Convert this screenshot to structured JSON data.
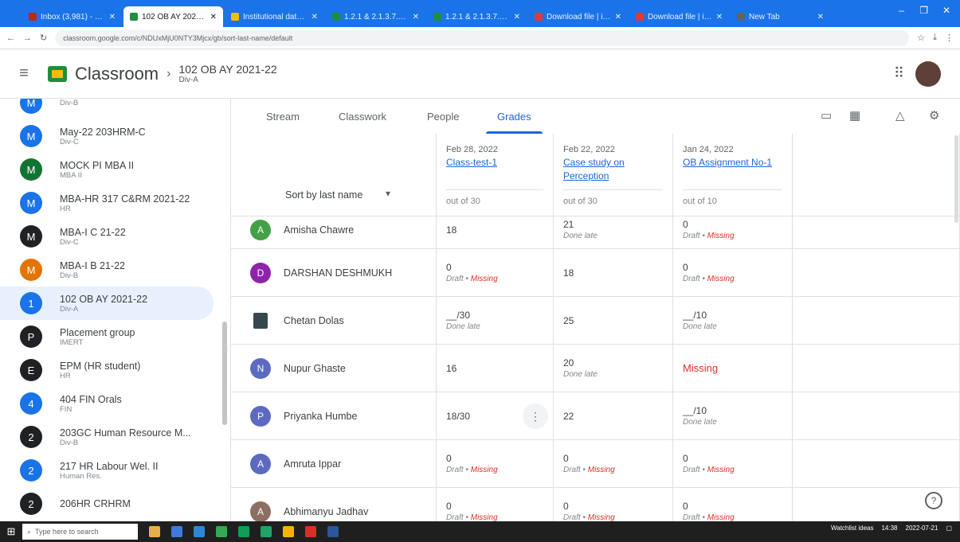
{
  "browser": {
    "tabs": [
      {
        "title": "Inbox (3,981) - vivekana...",
        "fav": "#c5221f",
        "active": false
      },
      {
        "title": "102 OB AY 2021-22 grade...",
        "fav": "#1e8e3e",
        "active": true
      },
      {
        "title": "Institutional data in the p...",
        "fav": "#fbbc04",
        "active": false
      },
      {
        "title": "1.2.1 & 2.1.3.7.xlsx - Goog...",
        "fav": "#1e8e3e",
        "active": false
      },
      {
        "title": "1.2.1 & 2.1.3.7.xlsx - Goog...",
        "fav": "#1e8e3e",
        "active": false
      },
      {
        "title": "Download file | iLovePDF",
        "fav": "#e53935",
        "active": false
      },
      {
        "title": "Download file | iLovePDF",
        "fav": "#e53935",
        "active": false
      },
      {
        "title": "New Tab",
        "fav": "#5f6368",
        "active": false
      }
    ],
    "url": "classroom.google.com/c/NDUxMjU0NTY3Mjcx/gb/sort-last-name/default"
  },
  "header": {
    "app_title": "Classroom",
    "class_name": "102 OB AY 2021-22",
    "class_section": "Div-A"
  },
  "sidebar": {
    "items": [
      {
        "initial": "M",
        "color": "#1a73e8",
        "name": "",
        "sub": "Div-B"
      },
      {
        "initial": "M",
        "color": "#1a73e8",
        "name": "May-22 203HRM-C",
        "sub": "Div-C"
      },
      {
        "initial": "M",
        "color": "#137333",
        "name": "MOCK PI MBA II",
        "sub": "MBA II"
      },
      {
        "initial": "M",
        "color": "#1a73e8",
        "name": "MBA-HR 317 C&RM 2021-22",
        "sub": "HR"
      },
      {
        "initial": "M",
        "color": "#202124",
        "name": "MBA-I C 21-22",
        "sub": "Div-C"
      },
      {
        "initial": "M",
        "color": "#e37400",
        "name": "MBA-I B 21-22",
        "sub": "Div-B"
      },
      {
        "initial": "1",
        "color": "#1a73e8",
        "name": "102 OB AY 2021-22",
        "sub": "Div-A",
        "selected": true
      },
      {
        "initial": "P",
        "color": "#202124",
        "name": "Placement group",
        "sub": "IMERT"
      },
      {
        "initial": "E",
        "color": "#202124",
        "name": "EPM (HR student)",
        "sub": "HR"
      },
      {
        "initial": "4",
        "color": "#1a73e8",
        "name": "404 FIN Orals",
        "sub": "FIN"
      },
      {
        "initial": "2",
        "color": "#202124",
        "name": "203GC Human Resource M...",
        "sub": "Div-B"
      },
      {
        "initial": "2",
        "color": "#1a73e8",
        "name": "217 HR Labour Wel. II",
        "sub": "Human Res."
      },
      {
        "initial": "2",
        "color": "#202124",
        "name": "206HR CRHRM",
        "sub": ""
      }
    ]
  },
  "tabs": {
    "stream": "Stream",
    "classwork": "Classwork",
    "people": "People",
    "grades": "Grades"
  },
  "grid": {
    "sort_label": "Sort by last name",
    "assignments": [
      {
        "date": "Feb 28, 2022",
        "title": "Class-test-1",
        "out_of": "out of 30"
      },
      {
        "date": "Feb 22, 2022",
        "title": "Case study on Perception",
        "out_of": "out of 30"
      },
      {
        "date": "Jan 24, 2022",
        "title": "OB Assignment No-1",
        "out_of": "out of 10"
      }
    ],
    "students": [
      {
        "name": "Amisha Chawre",
        "initial": "A",
        "color": "#43a047",
        "grades": [
          {
            "v": "18",
            "s": ""
          },
          {
            "v": "21",
            "s": "Done late"
          },
          {
            "v": "0",
            "s": "Draft",
            "miss": "Missing"
          }
        ]
      },
      {
        "name": "DARSHAN DESHMUKH",
        "initial": "D",
        "color": "#8e24aa",
        "grades": [
          {
            "v": "0",
            "s": "Draft",
            "miss": "Missing"
          },
          {
            "v": "18",
            "s": ""
          },
          {
            "v": "0",
            "s": "Draft",
            "miss": "Missing"
          }
        ]
      },
      {
        "name": "Chetan Dolas",
        "initial": "",
        "color": "#37474f",
        "grades": [
          {
            "v": "__/30",
            "s": "Done late"
          },
          {
            "v": "25",
            "s": ""
          },
          {
            "v": "__/10",
            "s": "Done late"
          }
        ]
      },
      {
        "name": "Nupur Ghaste",
        "initial": "N",
        "color": "#5c6bc0",
        "grades": [
          {
            "v": "16",
            "s": ""
          },
          {
            "v": "20",
            "s": "Done late"
          },
          {
            "v": "Missing",
            "s": "",
            "red": true
          }
        ]
      },
      {
        "name": "Priyanka Humbe",
        "initial": "P",
        "color": "#5c6bc0",
        "grades": [
          {
            "v": "18/30",
            "s": "",
            "kebab": true
          },
          {
            "v": "22",
            "s": ""
          },
          {
            "v": "__/10",
            "s": "Done late"
          }
        ]
      },
      {
        "name": "Amruta Ippar",
        "initial": "A",
        "color": "#5c6bc0",
        "grades": [
          {
            "v": "0",
            "s": "Draft",
            "miss": "Missing"
          },
          {
            "v": "0",
            "s": "Draft",
            "miss": "Missing"
          },
          {
            "v": "0",
            "s": "Draft",
            "miss": "Missing"
          }
        ]
      },
      {
        "name": "Abhimanyu Jadhav",
        "initial": "A",
        "color": "#8d6e63",
        "grades": [
          {
            "v": "0",
            "s": "Draft",
            "miss": "Missing"
          },
          {
            "v": "0",
            "s": "Draft",
            "miss": "Missing"
          },
          {
            "v": "0",
            "s": "Draft",
            "miss": "Missing"
          }
        ]
      }
    ]
  },
  "taskbar": {
    "search_placeholder": "Type here to search",
    "watchlist": "Watchlist ideas",
    "time": "14:38",
    "date": "2022-07-21"
  }
}
